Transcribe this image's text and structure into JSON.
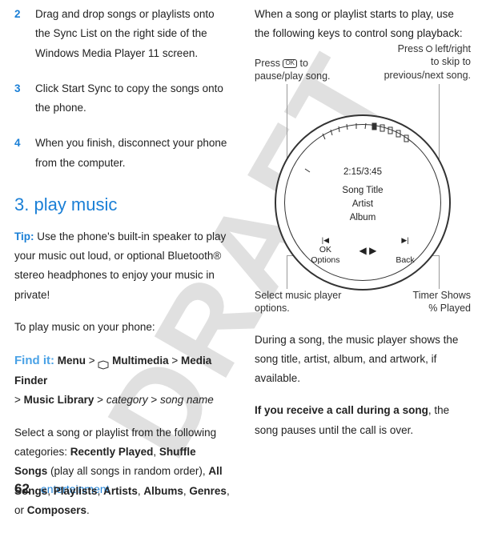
{
  "watermark": "DRAFT",
  "left": {
    "step2": {
      "num": "2",
      "text": "Drag and drop songs or playlists onto the Sync List on the right side of the Windows Media Player 11 screen."
    },
    "step3": {
      "num": "3",
      "text": "Click Start Sync to copy the songs onto the phone."
    },
    "step4": {
      "num": "4",
      "text": "When you finish, disconnect your phone from the computer."
    },
    "heading": "3. play music",
    "tip_label": "Tip:",
    "tip_text": " Use the phone's built-in speaker to play your music out loud, or optional Bluetooth® stereo headphones to enjoy your music in private!",
    "toplay": "To play music on your phone:",
    "find_label": "Find it:",
    "path": {
      "menu": "Menu",
      "gt1": " > ",
      "multimedia": " Multimedia",
      "gt2": " > ",
      "mediafinder": "Media Finder",
      "gt3": " > ",
      "musiclibrary": "Music Library",
      "gt4": " > ",
      "category": "category",
      "gt5": " > ",
      "songname": "song name"
    },
    "select_text": "Select a song or playlist from the following categories: ",
    "cats": {
      "recent": "Recently Played",
      "shuffle": "Shuffle Songs",
      "shuffle_note": " (play all songs in random order), ",
      "all": "All Songs",
      "playlists": "Playlists",
      "artists": "Artists",
      "albums": "Albums",
      "genres": "Genres",
      "composers": "Composers",
      "or": ", or ",
      "sep": ", "
    }
  },
  "right": {
    "intro": "When a song or playlist starts to play, use the following keys to control song playback:",
    "callouts": {
      "tl_1": "Press ",
      "tl_2": " to",
      "tl_3": "pause/play song.",
      "tr_1": "Press ",
      "tr_2": " left/right",
      "tr_3": "to skip to",
      "tr_4": "previous/next song.",
      "bl_1": "Select music player",
      "bl_2": "options.",
      "br_1": "Timer Shows",
      "br_2": "% Played"
    },
    "dial": {
      "time": "2:15/3:45",
      "title": "Song Title",
      "artist": "Artist",
      "album": "Album",
      "sk_left_icon": "▶",
      "sk_left_top": "OK",
      "sk_left_bottom": "Options",
      "sk_mid": "◀▶",
      "sk_right_icon": "▶|",
      "sk_right_bottom": "Back"
    },
    "during": "During a song, the music player shows the song title, artist, album, and artwork, if available.",
    "call_bold": "If you receive a call during a song",
    "call_rest": ", the song pauses until the call is over."
  },
  "footer": {
    "page": "62",
    "section": "entertainment"
  }
}
